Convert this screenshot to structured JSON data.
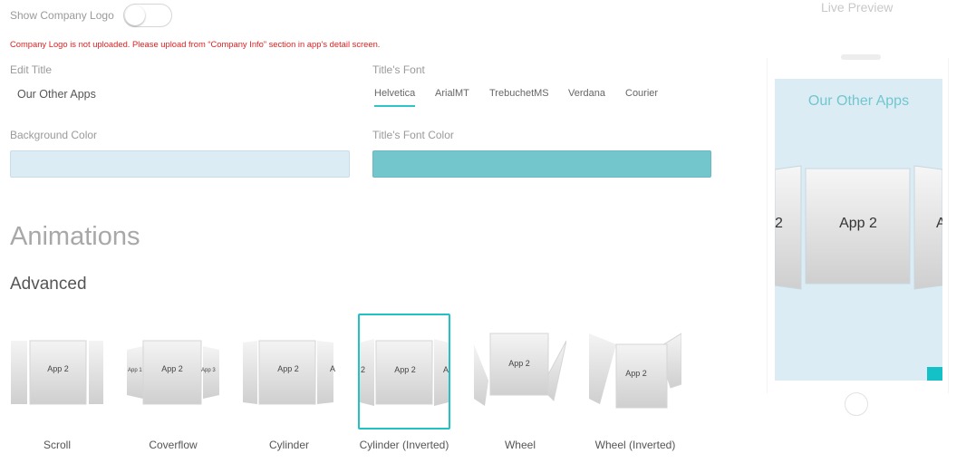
{
  "logo": {
    "label": "Show Company Logo",
    "enabled": false
  },
  "warning": "Company Logo is not uploaded. Please upload from “Company Info” section in app’s detail screen.",
  "edit_title": {
    "label": "Edit Title",
    "value": "Our Other Apps"
  },
  "title_font": {
    "label": "Title's Font",
    "options": [
      "Helvetica",
      "ArialMT",
      "TrebuchetMS",
      "Verdana",
      "Courier"
    ],
    "selected": "Helvetica"
  },
  "background_color": {
    "label": "Background Color",
    "value": "#dcecf5"
  },
  "title_font_color": {
    "label": "Title's Font Color",
    "value": "#74c6cd"
  },
  "animations": {
    "heading": "Animations",
    "subheading": "Advanced",
    "items": [
      {
        "name": "Scroll",
        "app_label": "App 2",
        "left_label": "",
        "right_label": ""
      },
      {
        "name": "Coverflow",
        "app_label": "App 2",
        "left_label": "App 1",
        "right_label": "App 3"
      },
      {
        "name": "Cylinder",
        "app_label": "App 2",
        "left_label": "",
        "right_label": "A"
      },
      {
        "name": "Cylinder (Inverted)",
        "app_label": "App 2",
        "left_label": "2",
        "right_label": "A"
      },
      {
        "name": "Wheel",
        "app_label": "App 2",
        "left_label": "",
        "right_label": ""
      },
      {
        "name": "Wheel (Inverted)",
        "app_label": "App 2",
        "left_label": "",
        "right_label": ""
      }
    ],
    "selected": "Cylinder (Inverted)"
  },
  "preview": {
    "label": "Live Preview",
    "title": "Our Other Apps",
    "center_app": "App 2",
    "left_label": "2",
    "right_label": "A"
  }
}
